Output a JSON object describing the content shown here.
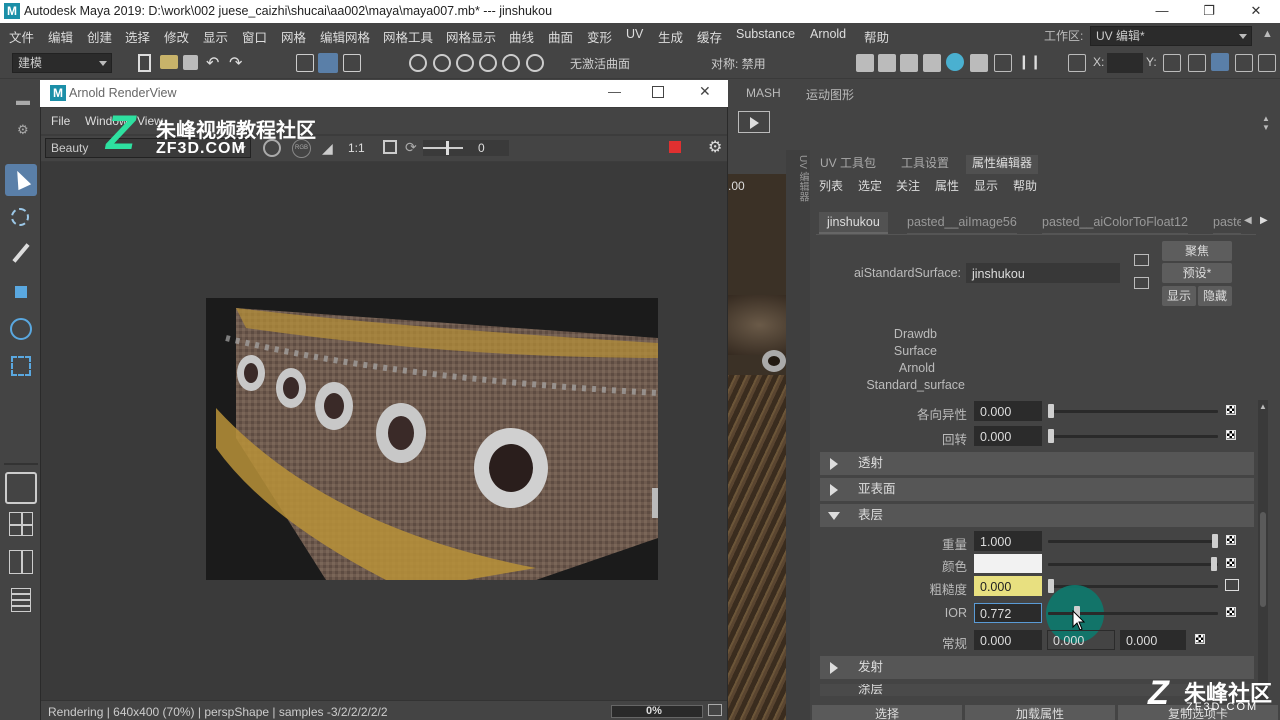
{
  "window": {
    "app_icon": "M",
    "title": "Autodesk Maya 2019: D:\\work\\002 juese_caizhi\\shucai\\aa002\\maya\\maya007.mb*   ---   jinshukou"
  },
  "menubar": {
    "items": [
      "文件",
      "编辑",
      "创建",
      "选择",
      "修改",
      "显示",
      "窗口",
      "网格",
      "编辑网格",
      "网格工具",
      "网格显示",
      "曲线",
      "曲面",
      "变形",
      "UV",
      "生成",
      "缓存",
      "Substance",
      "Arnold",
      "帮助"
    ],
    "workspace_label": "工作区:",
    "workspace_value": "UV 编辑*"
  },
  "toolbar": {
    "mode_select": "建模",
    "surface_label": "无激活曲面",
    "symmetry_label": "对称: 禁用",
    "x_label": "X:",
    "y_label": "Y:"
  },
  "shelf": {
    "tabs": [
      "MASH",
      "运动图形"
    ]
  },
  "renderview": {
    "title": "Arnold RenderView",
    "menu": [
      "File",
      "Window",
      "View"
    ],
    "aov_select": "Beauty",
    "ratio_label": "1:1",
    "exposure_value": "0",
    "status_text": "Rendering | 640x400 (70%) | perspShape  | samples -3/2/2/2/2/2",
    "progress": "0%",
    "progress_fraction": 0.0
  },
  "watermark": {
    "logo_text": "Z",
    "site_cn": "朱峰视频教程社区",
    "site_en": "ZF3D.COM",
    "corner_cn": "朱峰社区",
    "corner_en": "ZF3D.COM"
  },
  "viewport": {
    "partial_value": ".00"
  },
  "attribute_editor": {
    "vertical_tab": "UV 编辑器",
    "panel_tabs": [
      "UV 工具包",
      "工具设置",
      "属性编辑器"
    ],
    "active_panel_tab": "属性编辑器",
    "submenu": [
      "列表",
      "选定",
      "关注",
      "属性",
      "显示",
      "帮助"
    ],
    "node_tabs": [
      "jinshukou",
      "pasted__aiImage56",
      "pasted__aiColorToFloat12",
      "paste"
    ],
    "node_type_label": "aiStandardSurface:",
    "node_name": "jinshukou",
    "buttons": {
      "focus": "聚焦",
      "presets": "预设*",
      "show": "显示",
      "hide": "隐藏"
    },
    "classification": [
      "Drawdb",
      "Surface",
      "Arnold",
      "Standard_surface"
    ],
    "attrs_top": [
      {
        "label": "各向异性",
        "value": "0.000",
        "fraction": 0.0
      },
      {
        "label": "回转",
        "value": "0.000",
        "fraction": 0.0
      }
    ],
    "sections": {
      "transmission": "透射",
      "subsurface": "亚表面",
      "coat": "表层",
      "emission": "发射",
      "partial_next": "涂层"
    },
    "coat": {
      "weight_label": "重量",
      "weight_value": "1.000",
      "weight_fraction": 1.0,
      "color_label": "颜色",
      "color_hex": "#f2f2f2",
      "roughness_label": "粗糙度",
      "roughness_value": "0.000",
      "roughness_fraction": 0.0,
      "ior_label": "IOR",
      "ior_value": "0.772",
      "ior_fraction": 0.16,
      "normal_label": "常规",
      "normal_values": [
        "0.000",
        "0.000",
        "0.000"
      ]
    },
    "bottom_buttons": [
      "选择",
      "加载属性",
      "复制选项卡"
    ]
  },
  "colors": {
    "roughness_field_bg": "#e8e080",
    "ior_focus_border": "#5a9bd6",
    "cursor_highlight": "#0d7a6e",
    "maya_teal": "#1b8fa8",
    "render_stop_red": "#e03030"
  }
}
